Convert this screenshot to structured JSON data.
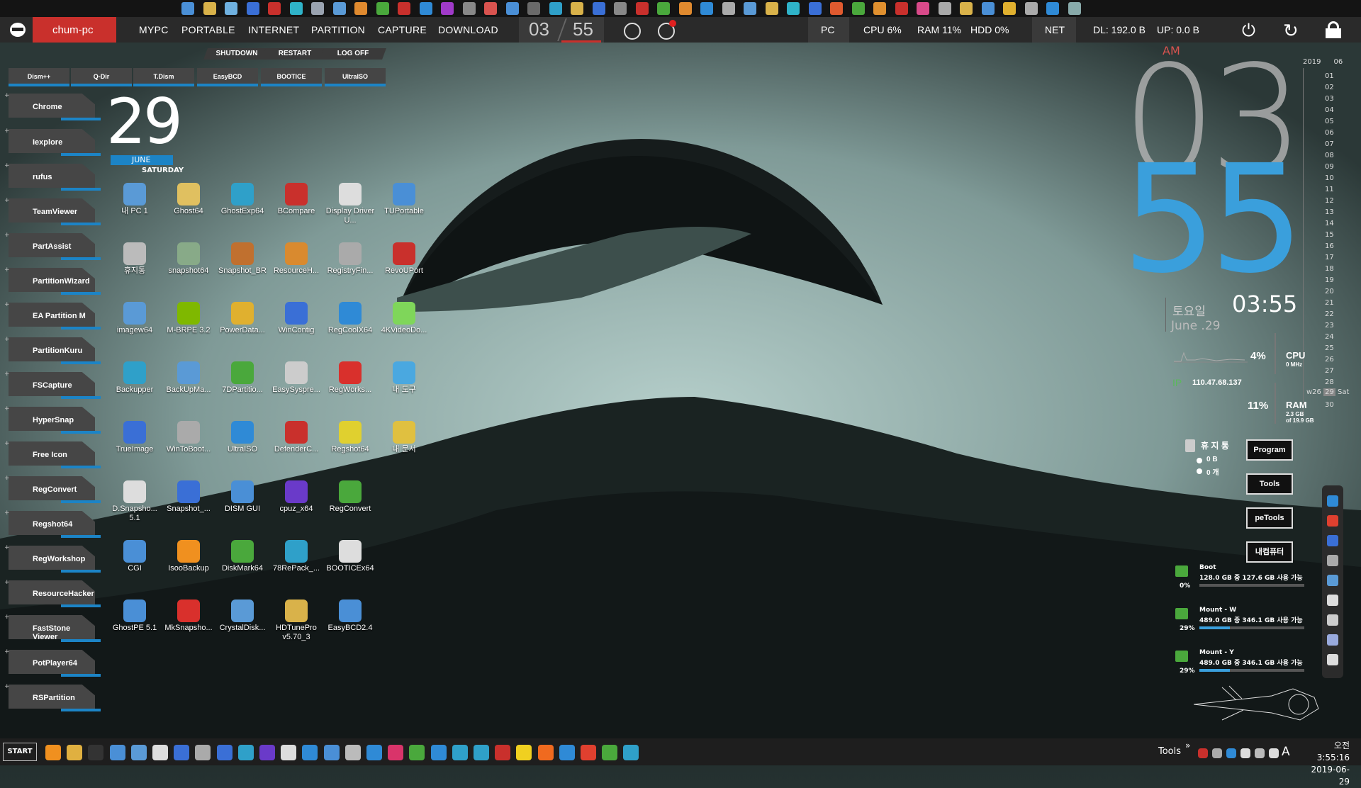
{
  "menu": {
    "hostname": "chum-pc",
    "items": [
      "MYPC",
      "PORTABLE",
      "INTERNET",
      "PARTITION",
      "CAPTURE",
      "DOWNLOAD"
    ],
    "hour": "03",
    "minute": "55",
    "pc_label": "PC",
    "cpu": "CPU  6%",
    "ram": "RAM  11%",
    "hdd": "HDD  0%",
    "net_label": "NET",
    "dl": "DL: 192.0 B",
    "up": "UP: 0.0 B"
  },
  "power_tabs": [
    "SHUTDOWN",
    "RESTART",
    "LOG OFF"
  ],
  "quick_tabs": [
    "Dism++",
    "Q-Dir",
    "T.Dism",
    "EasyBCD",
    "BOOTICE",
    "UltraISO"
  ],
  "launcher": [
    "Chrome",
    "Iexplore",
    "rufus",
    "TeamViewer",
    "PartAssist",
    "PartitionWizard",
    "EA Partition M",
    "PartitionKuru",
    "FSCapture",
    "HyperSnap",
    "Free Icon",
    "RegConvert",
    "Regshot64",
    "RegWorkshop",
    "ResourceHacker",
    "FastStone Viewer",
    "PotPlayer64",
    "RSPartition"
  ],
  "date_widget": {
    "day": "29",
    "month": "JUNE",
    "weekday": "SATURDAY"
  },
  "desktop_icons": [
    [
      "내 PC 1",
      "Ghost64",
      "GhostExp64",
      "BCompare",
      "Display Driver U...",
      "TUPortable"
    ],
    [
      "휴지통",
      "snapshot64",
      "Snapshot_BR",
      "ResourceH...",
      "RegistryFin...",
      "RevoUPort"
    ],
    [
      "imagew64",
      "M-BRPE 3.2",
      "PowerData...",
      "WinContig",
      "RegCoolX64",
      "4KVideoDo..."
    ],
    [
      "Backupper",
      "BackUpMa...",
      "7DPartitio...",
      "EasySyspre...",
      "RegWorks...",
      "내 도구"
    ],
    [
      "TrueImage",
      "WinToBoot...",
      "UltraISO",
      "DefenderC...",
      "Regshot64",
      "내 문서"
    ],
    [
      "D.Snapsho... 5.1",
      "Snapshot_...",
      "DISM GUI",
      "cpuz_x64",
      "RegConvert",
      ""
    ],
    [
      "CGI",
      "IsooBackup",
      "DiskMark64",
      "78RePack_...",
      "BOOTICEx64",
      ""
    ],
    [
      "GhostPE 5.1",
      "MkSnapsho...",
      "CrystalDisk...",
      "HDTunePro v5.70_3",
      "EasyBCD2.4",
      ""
    ]
  ],
  "clock": {
    "ampm": "AM",
    "hour": "03",
    "minute": "55",
    "time": "03:55",
    "weekday_kr": "토요일",
    "date": "June .29"
  },
  "calendar": {
    "year": "2019",
    "month": "06",
    "days": [
      "01",
      "02",
      "03",
      "04",
      "05",
      "06",
      "07",
      "08",
      "09",
      "10",
      "11",
      "12",
      "13",
      "14",
      "15",
      "16",
      "17",
      "18",
      "19",
      "20",
      "21",
      "22",
      "23",
      "24",
      "25",
      "26",
      "27",
      "28",
      "29",
      "30"
    ],
    "week": "w26",
    "today": "29",
    "today_name": "Sat"
  },
  "monitor": {
    "cpu_pct": "4%",
    "cpu_label": "CPU",
    "cpu_mhz": "0 MHz",
    "ip_label": "IP",
    "ip": "110.47.68.137",
    "ram_pct": "11%",
    "ram_label": "RAM",
    "ram_used": "2.3 GB",
    "ram_total": "of 19.9 GB"
  },
  "recycle": {
    "label": "휴 지 통",
    "size": "0 B",
    "count": "0 개"
  },
  "buttons": [
    "Program",
    "Tools",
    "peTools",
    "내컴퓨터"
  ],
  "drives": [
    {
      "name": "Boot",
      "info": "128.0 GB 중 127.6 GB 사용 가능",
      "pct": "0%",
      "fill": 0
    },
    {
      "name": "Mount - W",
      "info": "489.0 GB 중 346.1 GB 사용 가능",
      "pct": "29%",
      "fill": 0.29
    },
    {
      "name": "Mount - Y",
      "info": "489.0 GB 중 346.1 GB 사용 가능",
      "pct": "29%",
      "fill": 0.29
    }
  ],
  "taskbar": {
    "start": "START",
    "tools": "Tools",
    "time": "오전 3:55:16",
    "date": "2019-06-29",
    "ime": "A"
  },
  "colors": {
    "accent_red": "#c9302c",
    "accent_blue": "#3a9fdc",
    "drive_green": "#4aa83c"
  }
}
